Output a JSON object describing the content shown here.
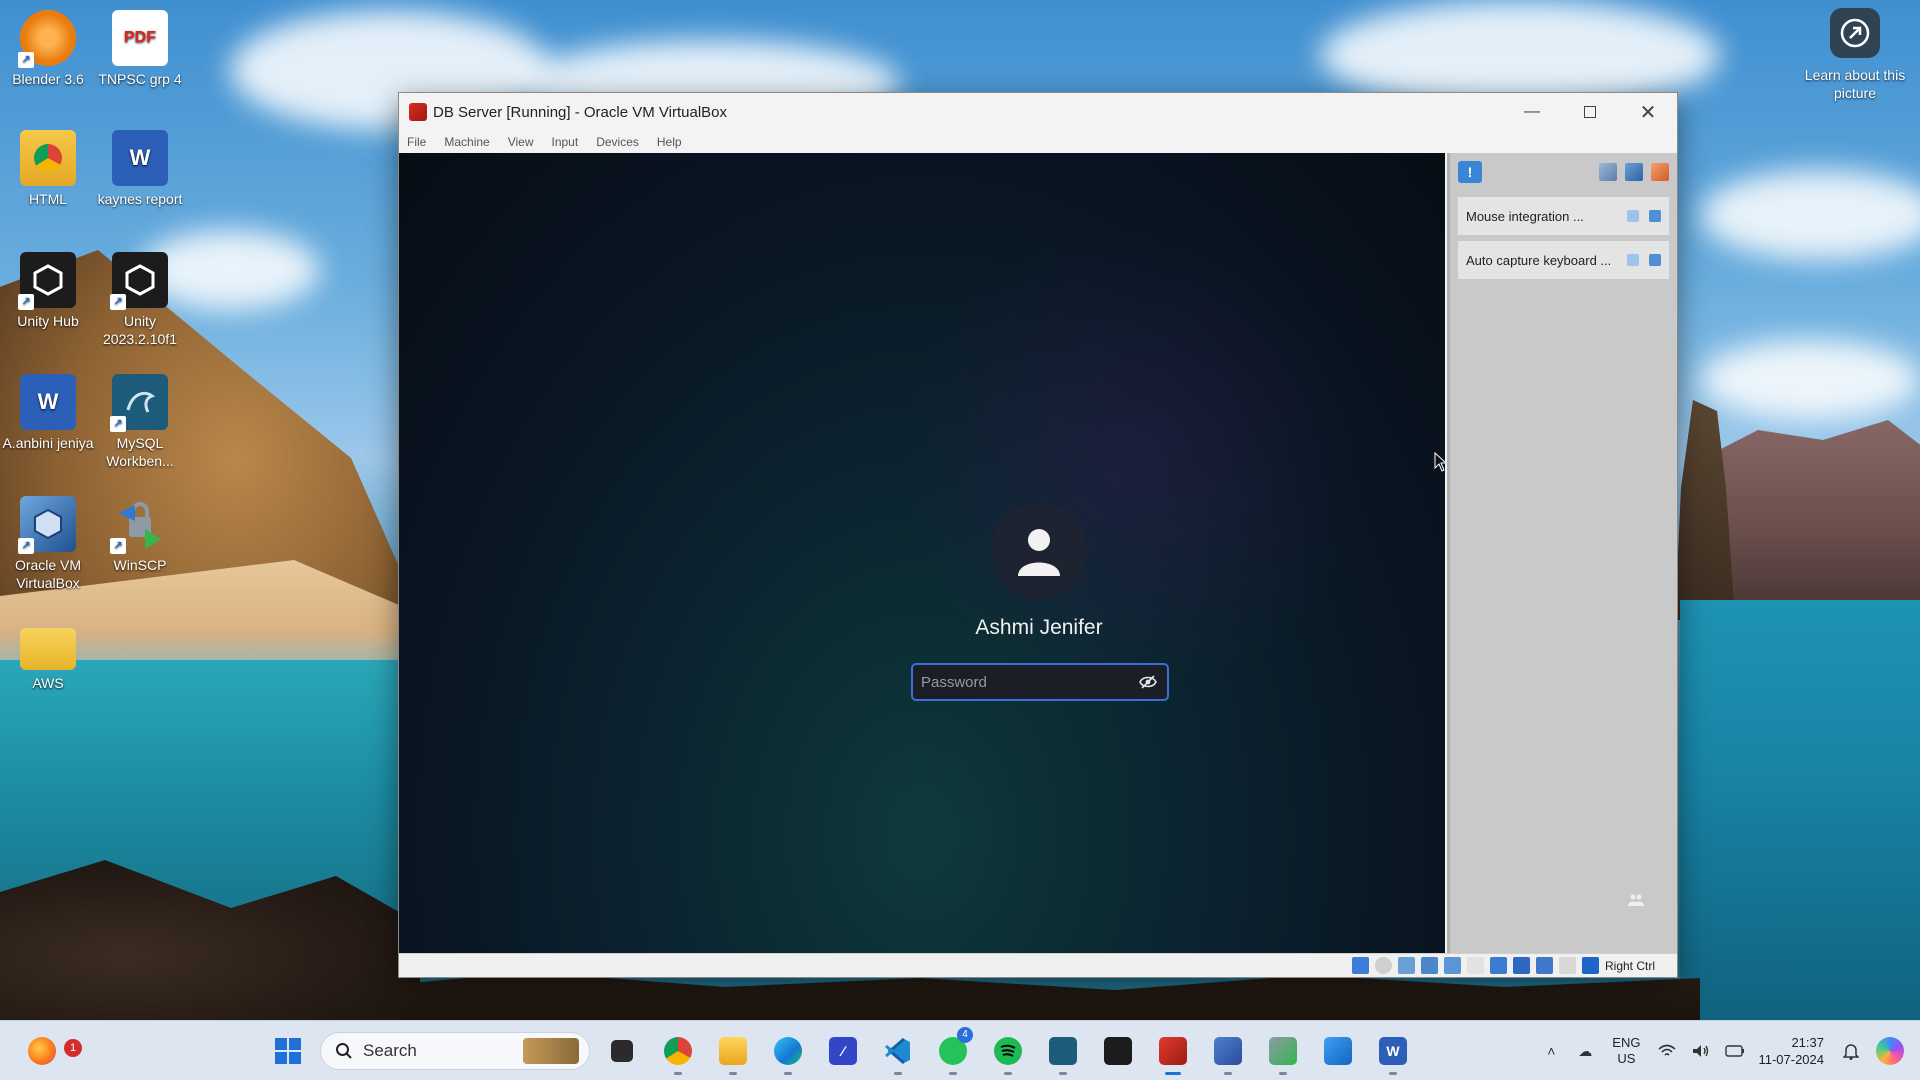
{
  "desktop": {
    "icons": [
      {
        "label": "Blender 3.6"
      },
      {
        "label": "TNPSC grp 4",
        "glyph": "PDF"
      },
      {
        "label": "HTML"
      },
      {
        "label": "kaynes report",
        "glyph": "W"
      },
      {
        "label": "Unity Hub"
      },
      {
        "label": "Unity 2023.2.10f1"
      },
      {
        "label": "A.anbini jeniya",
        "glyph": "W"
      },
      {
        "label": "MySQL Workben..."
      },
      {
        "label": "Oracle VM VirtualBox"
      },
      {
        "label": "WinSCP"
      },
      {
        "label": "AWS"
      }
    ],
    "learn_widget": {
      "label": "Learn about this picture"
    }
  },
  "vbox": {
    "title": "DB Server [Running] - Oracle VM VirtualBox",
    "menu": [
      "File",
      "Machine",
      "View",
      "Input",
      "Devices",
      "Help"
    ],
    "login": {
      "username": "Ashmi Jenifer",
      "password_placeholder": "Password",
      "password_value": ""
    },
    "notifications": [
      {
        "label": "Mouse integration ..."
      },
      {
        "label": "Auto capture keyboard ..."
      }
    ],
    "statusbar": {
      "host_key": "Right Ctrl"
    }
  },
  "taskbar": {
    "search_label": "Search",
    "firefox_badge": "1",
    "whatsapp_badge": "4",
    "language": "ENG",
    "region": "US",
    "time": "21:37",
    "date": "11-07-2024"
  },
  "colors": {
    "accent": "#3a6fd8",
    "vm_background": "#0a1624",
    "panel": "#c9c9c9",
    "taskbar": "#dde6f0"
  }
}
